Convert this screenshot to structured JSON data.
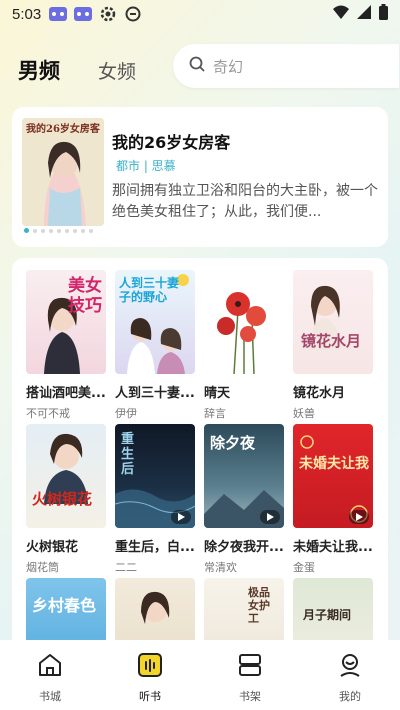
{
  "status_bar": {
    "time": "5:03"
  },
  "tabs": {
    "male": "男频",
    "female": "女频"
  },
  "search": {
    "placeholder": "奇幻"
  },
  "featured": {
    "title": "我的26岁女房客",
    "tags": "都市 | 思慕",
    "description": "那间拥有独立卫浴和阳台的大主卧，被一个绝色美女租住了；从此，我们便...",
    "cover_text": "我的26岁女房客",
    "dot_count": 9,
    "active_dot": 0
  },
  "books": [
    {
      "title": "搭讪酒吧美...",
      "author": "不可不戒",
      "cover_text": "美女技巧",
      "has_play": false
    },
    {
      "title": "人到三十妻...",
      "author": "伊伊",
      "cover_text": "人到三十妻子的野心",
      "has_play": false
    },
    {
      "title": "晴天",
      "author": "辞言",
      "cover_text": "",
      "has_play": false
    },
    {
      "title": "镜花水月",
      "author": "妖兽",
      "cover_text": "镜花水月",
      "has_play": false
    },
    {
      "title": "火树银花",
      "author": "烟花筒",
      "cover_text": "火树银花",
      "has_play": false
    },
    {
      "title": "重生后，白...",
      "author": "二二",
      "cover_text": "重生后",
      "has_play": true
    },
    {
      "title": "除夕夜我开...",
      "author": "常清欢",
      "cover_text": "除夕夜",
      "has_play": true
    },
    {
      "title": "未婚夫让我...",
      "author": "金蛋",
      "cover_text": "未婚夫让我",
      "has_play": true
    },
    {
      "title": "",
      "author": "",
      "cover_text": "乡村春色",
      "has_play": false
    },
    {
      "title": "",
      "author": "",
      "cover_text": "",
      "has_play": false
    },
    {
      "title": "",
      "author": "",
      "cover_text": "极品女护工",
      "has_play": false
    },
    {
      "title": "",
      "author": "",
      "cover_text": "月子期间",
      "has_play": false
    }
  ],
  "bottom_nav": [
    {
      "label": "书城",
      "icon": "home-icon",
      "active": false
    },
    {
      "label": "听书",
      "icon": "audio-icon",
      "active": true
    },
    {
      "label": "书架",
      "icon": "bookshelf-icon",
      "active": false
    },
    {
      "label": "我的",
      "icon": "profile-icon",
      "active": false
    }
  ],
  "colors": {
    "accent": "#3bb1c7",
    "audio_icon": "#f5d42a"
  }
}
